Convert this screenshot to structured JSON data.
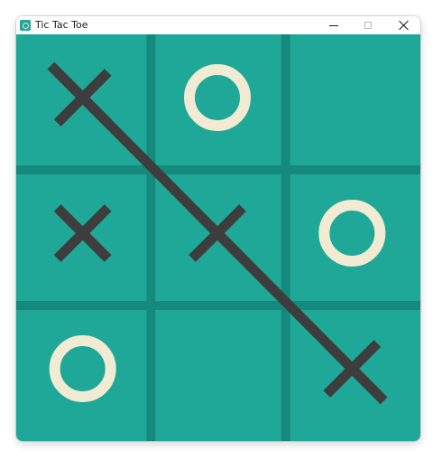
{
  "window": {
    "title": "Tic Tac Toe",
    "app_icon": "tic-tac-toe-app-icon",
    "controls": [
      "minimize-icon",
      "maximize-icon",
      "close-icon"
    ]
  },
  "game": {
    "board": [
      [
        "X",
        "O",
        ""
      ],
      [
        "X",
        "X",
        "O"
      ],
      [
        "O",
        "",
        "X"
      ]
    ],
    "winner": "X",
    "winning_line": [
      [
        0,
        0
      ],
      [
        1,
        1
      ],
      [
        2,
        2
      ]
    ]
  },
  "colors": {
    "board_background": "#1fa898",
    "grid_lines": "#15897c",
    "x_mark": "#3d3d3d",
    "o_mark": "#f2ebd3",
    "win_line": "#3d3d3d"
  }
}
